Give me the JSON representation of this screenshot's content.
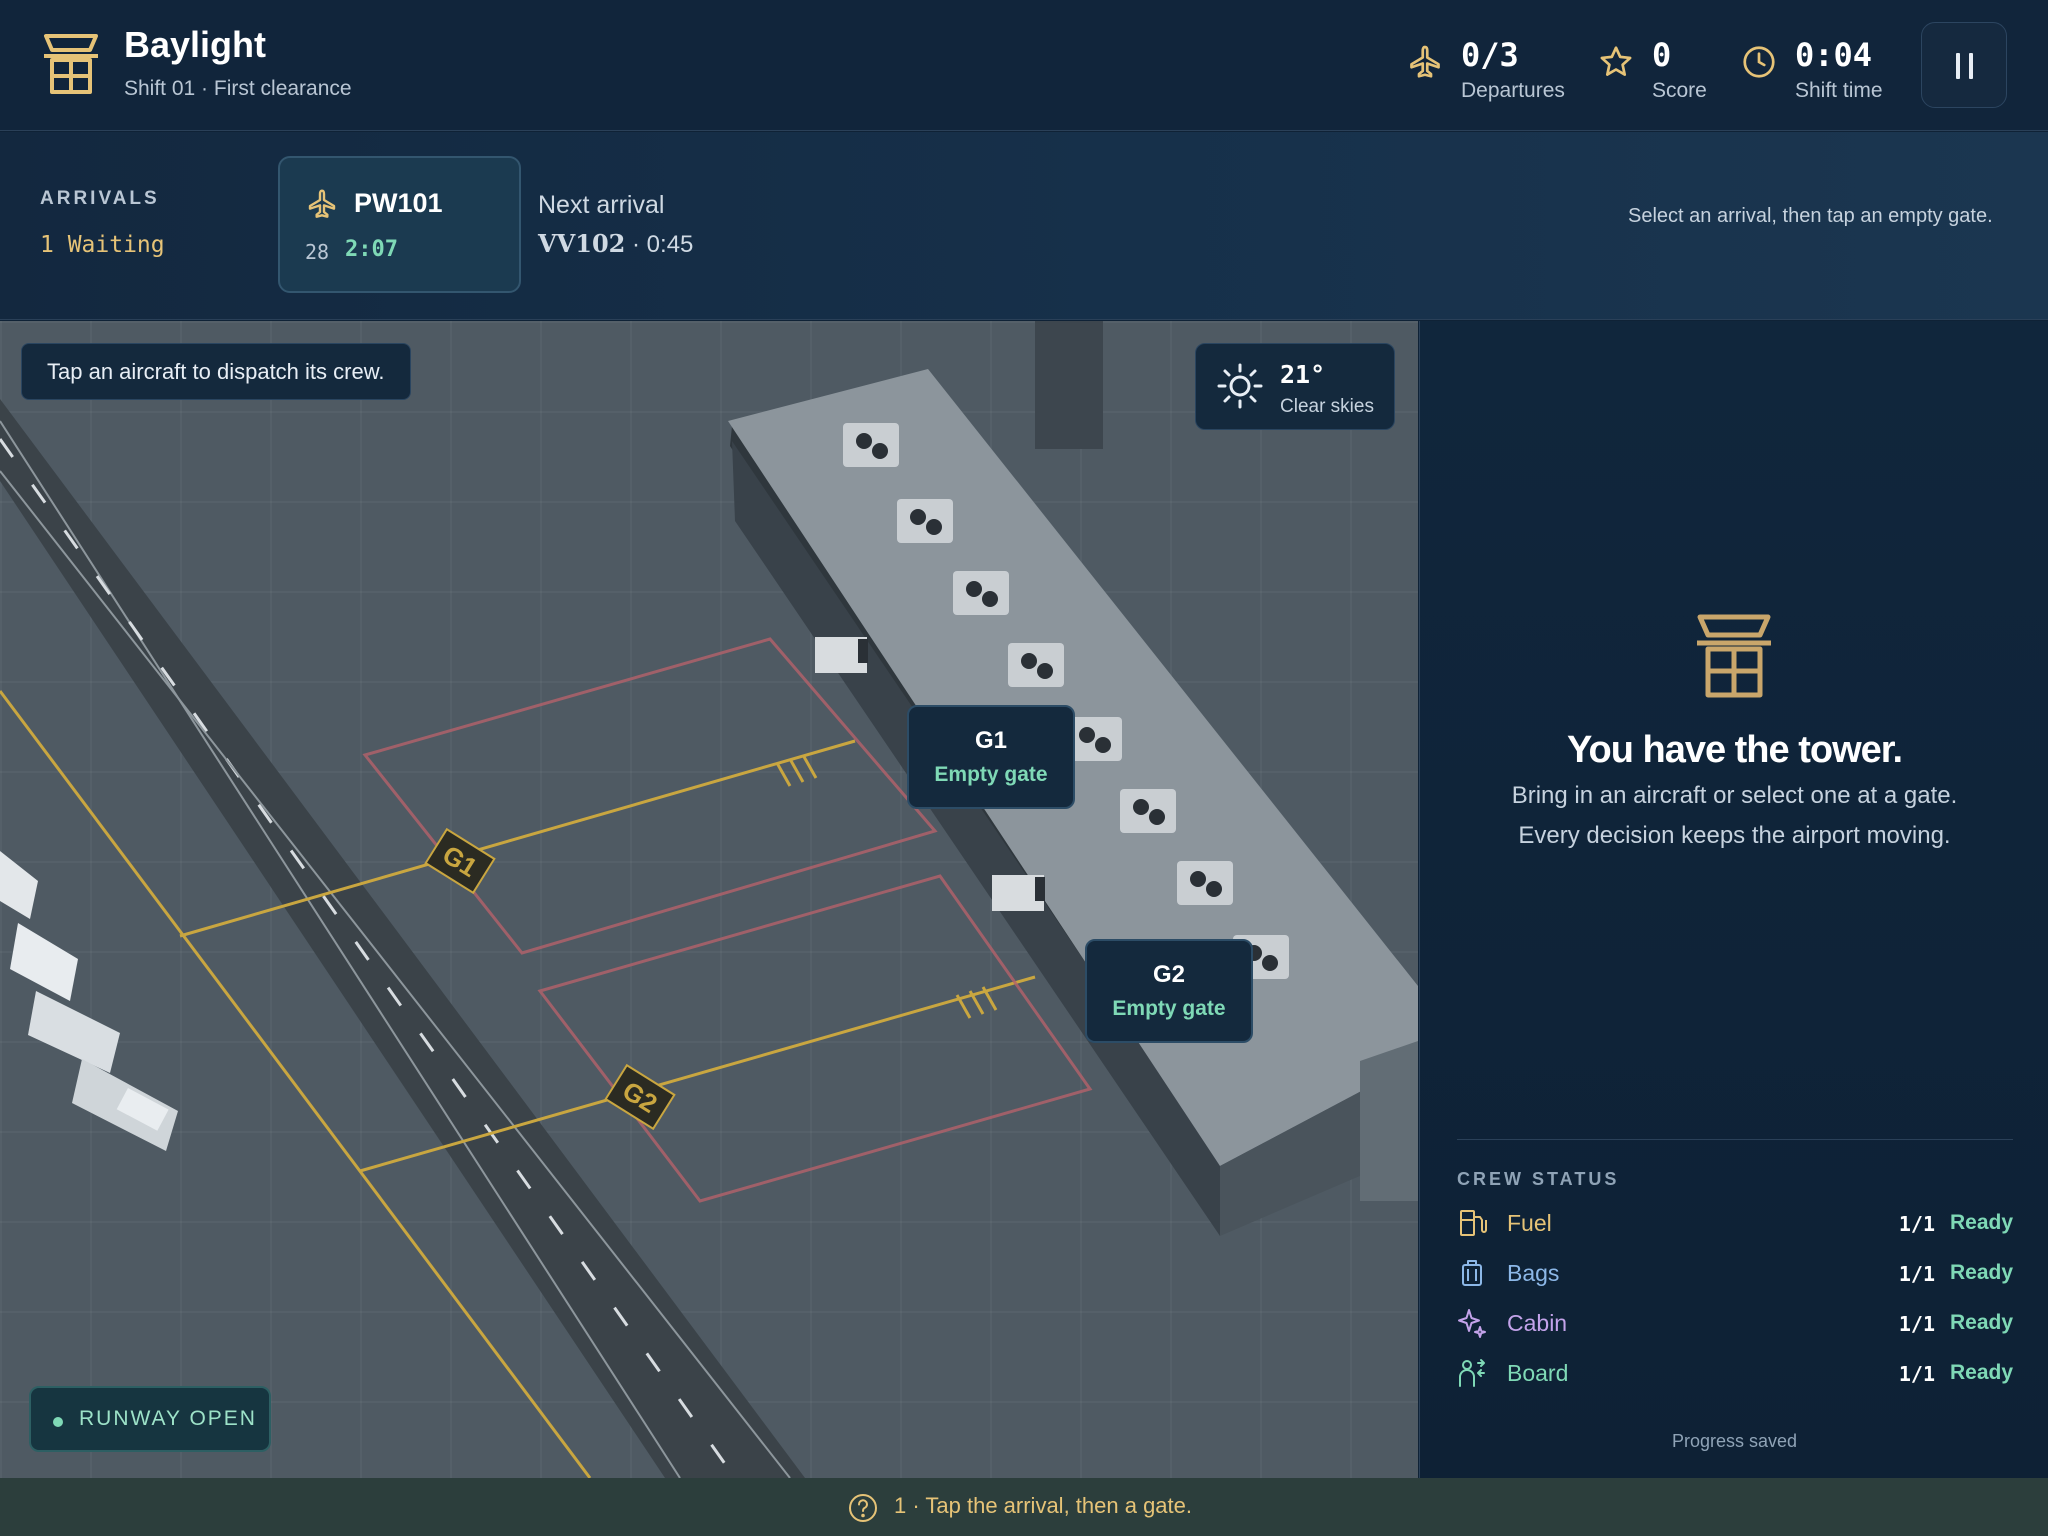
{
  "header": {
    "title": "Baylight",
    "subtitle": "Shift 01 · First clearance",
    "stats": {
      "departures": {
        "value": "0/3",
        "label": "Departures"
      },
      "score": {
        "value": "0",
        "label": "Score"
      },
      "time": {
        "value": "0:04",
        "label": "Shift time"
      }
    },
    "pause_label": "Pause"
  },
  "arrivals": {
    "heading": "ARRIVALS",
    "waiting": "1 Waiting",
    "current": {
      "code": "PW101",
      "runway": "28",
      "timer": "2:07"
    },
    "next": {
      "label": "Next arrival",
      "code": "VV102",
      "eta": "0:45"
    },
    "hint": "Select an arrival, then tap an empty gate."
  },
  "map": {
    "hint": "Tap an aircraft to dispatch its crew.",
    "weather": {
      "temp": "21°",
      "desc": "Clear skies"
    },
    "gates": [
      {
        "name": "G1",
        "status": "Empty gate",
        "marking": "G1"
      },
      {
        "name": "G2",
        "status": "Empty gate",
        "marking": "G2"
      }
    ],
    "runway_status": "RUNWAY OPEN"
  },
  "panel": {
    "title": "You have the tower.",
    "line1": "Bring in an aircraft or select one at a gate.",
    "line2": "Every decision keeps the airport moving.",
    "crew_heading": "CREW STATUS",
    "crew": [
      {
        "name": "Fuel",
        "count": "1/1",
        "state": "Ready",
        "icon": "fuel-pump-icon",
        "color": "#e6c377"
      },
      {
        "name": "Bags",
        "count": "1/1",
        "state": "Ready",
        "icon": "luggage-icon",
        "color": "#8cb8e8"
      },
      {
        "name": "Cabin",
        "count": "1/1",
        "state": "Ready",
        "icon": "sparkle-icon",
        "color": "#c3a3ea"
      },
      {
        "name": "Board",
        "count": "1/1",
        "state": "Ready",
        "icon": "boarding-icon",
        "color": "#7fd9b6"
      }
    ],
    "saved": "Progress saved"
  },
  "tutorial": {
    "text": "1 · Tap the arrival, then a gate."
  },
  "colors": {
    "accent": "#e6c377",
    "ready": "#7fd9b6",
    "bg": "#0f2236"
  }
}
